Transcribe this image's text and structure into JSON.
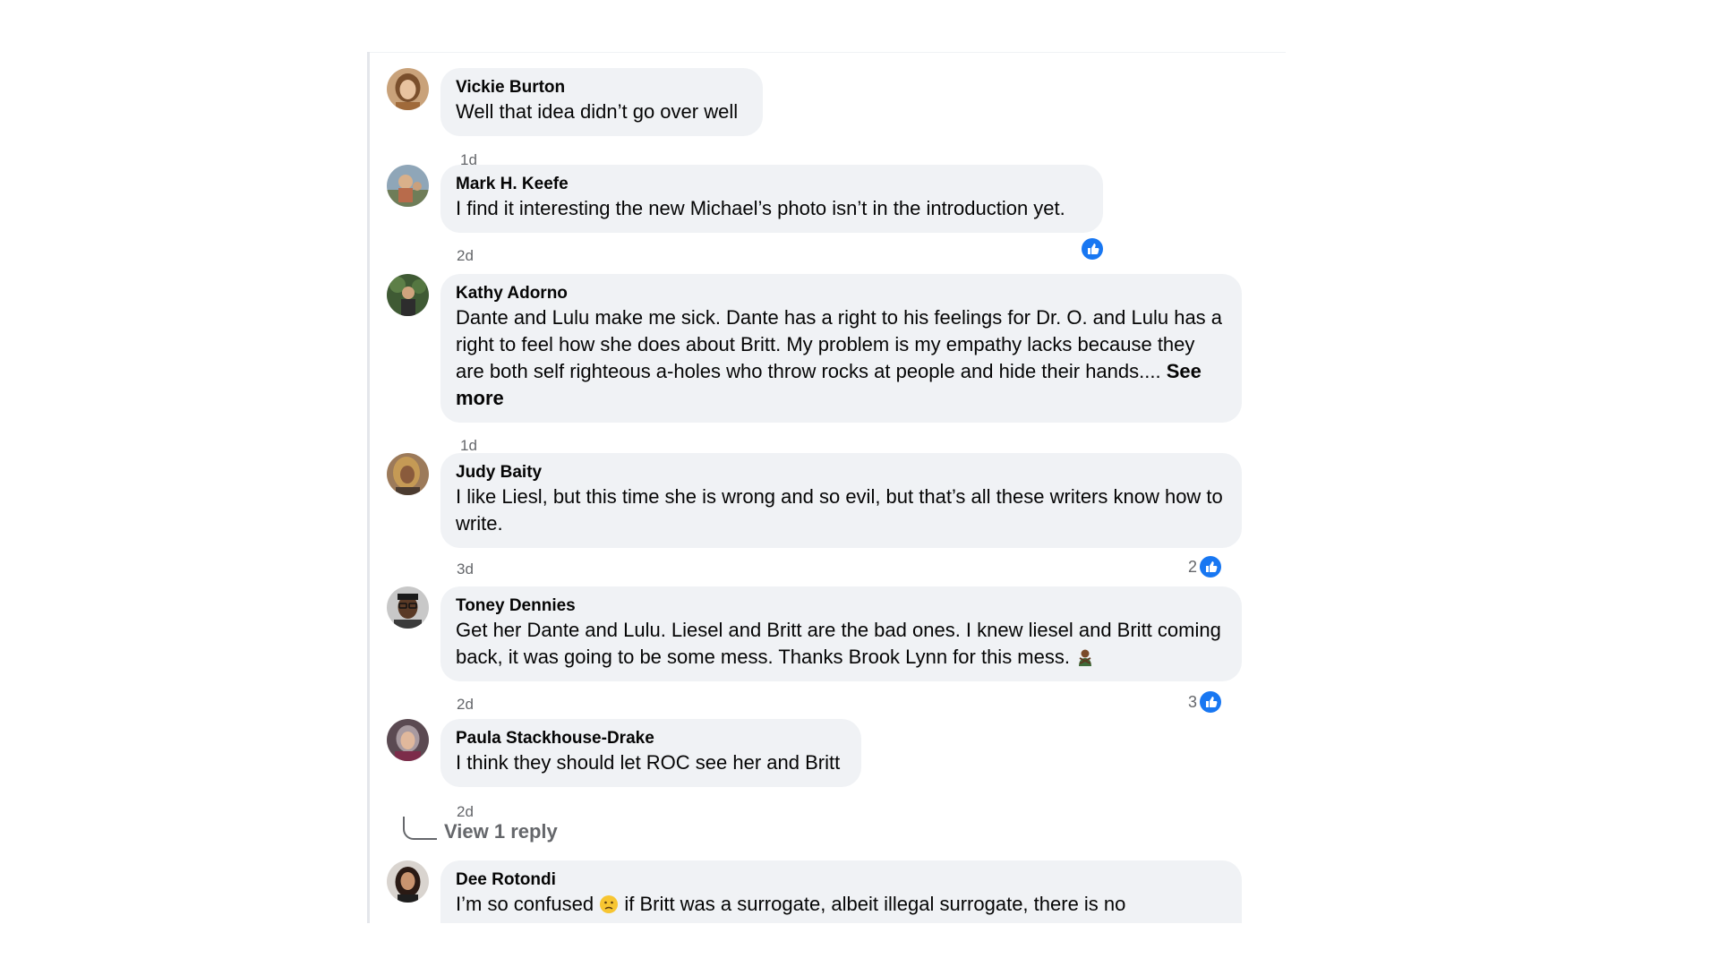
{
  "comments": [
    {
      "author": "Vickie Burton",
      "text": "Well that idea didn’t go over well",
      "time": "1d"
    },
    {
      "author": "Mark H. Keefe",
      "text": "I find it interesting the new Michael’s photo isn’t in the introduction yet.",
      "time": "2d",
      "reactions": {
        "icon": "like-icon"
      }
    },
    {
      "author": "Kathy Adorno",
      "text": "Dante and Lulu make me sick. Dante has a right to his feelings for Dr. O. and Lulu has a right to feel how she does about Britt. My problem is my empathy lacks because they are both self righteous a-holes who throw rocks at people and hide their hands.... ",
      "see_more": "See more",
      "time": "1d"
    },
    {
      "author": "Judy Baity",
      "text": "I like Liesl, but this time she is wrong and so evil, but that’s all these writers know how to write.",
      "time": "3d",
      "reactions": {
        "count": "2",
        "icon": "like-icon"
      }
    },
    {
      "author": "Toney Dennies",
      "text": "Get her Dante and Lulu. Liesel and Britt are the bad ones. I knew liesel and Britt coming back, it was going to be some mess. Thanks Brook Lynn for this mess.",
      "emoji": "person-gesturing-no-emoji",
      "time": "2d",
      "reactions": {
        "count": "3",
        "icon": "like-icon"
      }
    },
    {
      "author": "Paula Stackhouse-Drake",
      "text": "I think they should let ROC see her and Britt",
      "time": "2d",
      "view_replies": "View 1 reply"
    },
    {
      "author": "Dee Rotondi",
      "text_before_emoji": "I’m so confused",
      "emoji": "confused-face-emoji",
      "text_after_emoji": "if Britt was a surrogate, albeit illegal surrogate, there is no"
    }
  ],
  "colors": {
    "bubble": "#f0f2f5",
    "text": "#050505",
    "meta": "#65676b",
    "like": "#1877f2"
  }
}
